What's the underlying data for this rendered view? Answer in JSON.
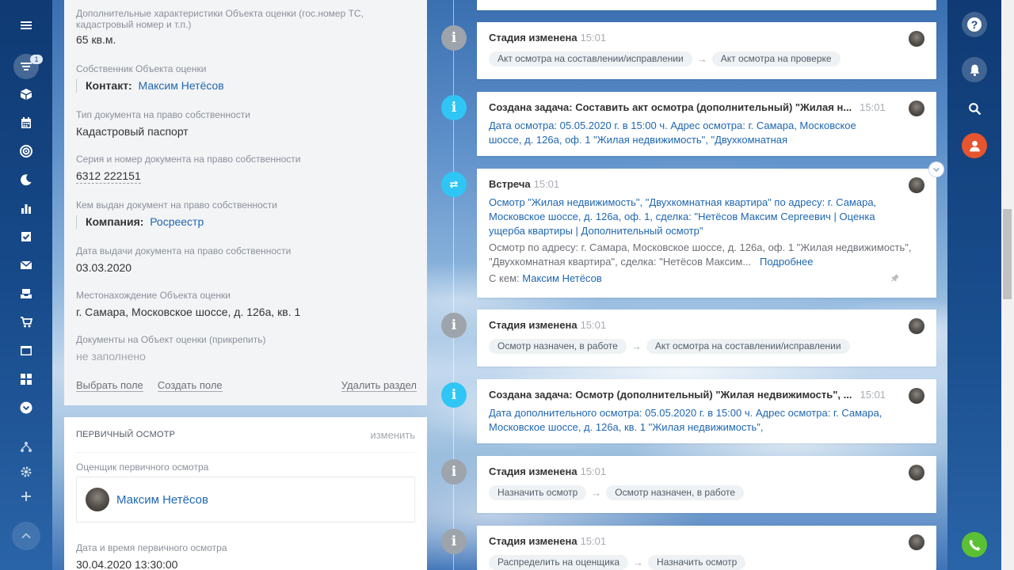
{
  "left_nav": {
    "badge_count": "1"
  },
  "object_fields": [
    {
      "label": "Дополнительные характеристики Объекта оценки (гос.номер ТС, кадастровый номер и т.п.)",
      "value": "65 кв.м."
    },
    {
      "label": "Собственник Объекта оценки",
      "prefix": "Контакт:",
      "value": "Максим Нетёсов"
    },
    {
      "label": "Тип документа на право собственности",
      "value": "Кадастровый паспорт"
    },
    {
      "label": "Серия и номер документа на право собственности",
      "value": "6312 222151"
    },
    {
      "label": "Кем выдан документ на право собственности",
      "prefix": "Компания:",
      "value": "Росреестр"
    },
    {
      "label": "Дата выдачи документа на право собственности",
      "value": "03.03.2020"
    },
    {
      "label": "Местонахождение Объекта оценки",
      "value": "г. Самара, Московское шоссе, д. 126а, кв. 1"
    },
    {
      "label": "Документы на Объект оценки (прикрепить)",
      "value": "не заполнено"
    }
  ],
  "field_actions": {
    "select": "Выбрать поле",
    "create": "Создать поле",
    "delete": "Удалить раздел"
  },
  "primary_inspection": {
    "title": "ПЕРВИЧНЫЙ ОСМОТР",
    "edit": "изменить",
    "appraiser_label": "Оценщик первичного осмотра",
    "appraiser_name": "Максим Нетёсов",
    "datetime_label": "Дата и время первичного осмотра",
    "datetime_value": "30.04.2020 13:30:00"
  },
  "timeline": [
    {
      "type": "stage",
      "title": "Стадия изменена",
      "time": "15:01",
      "from": "Акт осмотра на составлении/исправлении",
      "to": "Акт осмотра на проверке"
    },
    {
      "type": "task",
      "title": "Создана задача: Составить акт осмотра (дополнительный) \"Жилая н...",
      "time": "15:01",
      "text": "Дата осмотра: 05.05.2020 г. в 15:00 ч. Адрес осмотра: г. Самара, Московское шоссе, д. 126а, оф. 1 \"Жилая недвижимость\", \"Двухкомнатная"
    },
    {
      "type": "meeting",
      "title": "Встреча",
      "time": "15:01",
      "link": "Осмотр \"Жилая недвижимость\", \"Двухкомнатная квартира\" по адресу: г. Самара, Московское шоссе, д. 126а, оф. 1, сделка: \"Нетёсов Максим Сергеевич | Оценка ущерба квартиры | Дополнительный осмотр\"",
      "desc": "Осмотр по адресу: г. Самара, Московское шоссе, д. 126а, оф. 1 \"Жилая недвижимость\", \"Двухкомнатная квартира\", сделка: \"Нетёсов Максим...",
      "more": "Подробнее",
      "with_label": "С кем:",
      "with_name": "Максим Нетёсов"
    },
    {
      "type": "stage",
      "title": "Стадия изменена",
      "time": "15:01",
      "from": "Осмотр назначен, в работе",
      "to": "Акт осмотра на составлении/исправлении"
    },
    {
      "type": "task",
      "title": "Создана задача: Осмотр (дополнительный) \"Жилая недвижимость\", ...",
      "time": "15:01",
      "text": "Дата дополнительного осмотра: 05.05.2020 г. в 15:00 ч. Адрес осмотра: г. Самара, Московское шоссе, д. 126а, кв. 1 \"Жилая недвижимость\","
    },
    {
      "type": "stage",
      "title": "Стадия изменена",
      "time": "15:01",
      "from": "Назначить осмотр",
      "to": "Осмотр назначен, в работе"
    },
    {
      "type": "stage",
      "title": "Стадия изменена",
      "time": "15:01",
      "from": "Распределить на оценщика",
      "to": "Назначить осмотр"
    }
  ],
  "right_bar": {
    "help": "?"
  }
}
